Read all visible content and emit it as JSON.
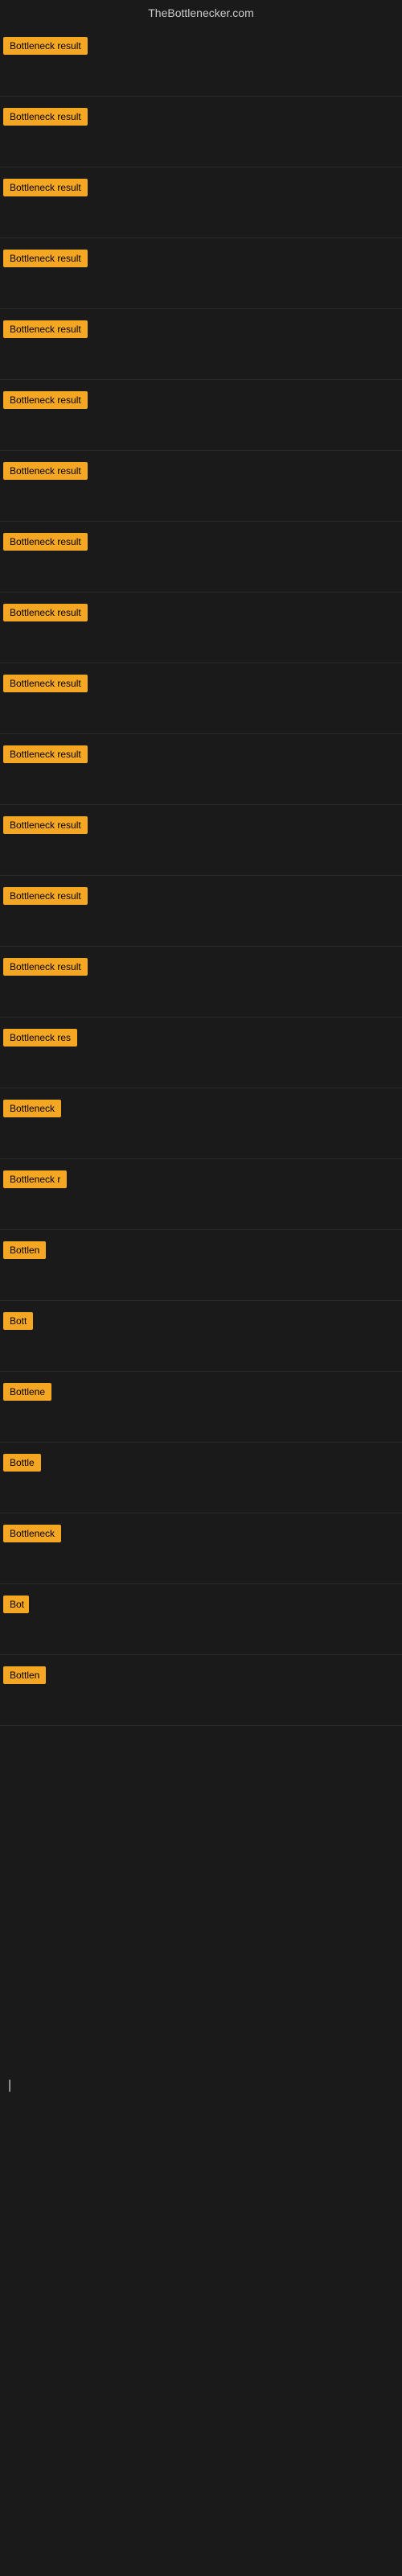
{
  "site": {
    "title": "TheBottlenecker.com"
  },
  "rows": [
    {
      "label": "Bottleneck result",
      "width": "full"
    },
    {
      "label": "Bottleneck result",
      "width": "full"
    },
    {
      "label": "Bottleneck result",
      "width": "full"
    },
    {
      "label": "Bottleneck result",
      "width": "full"
    },
    {
      "label": "Bottleneck result",
      "width": "full"
    },
    {
      "label": "Bottleneck result",
      "width": "full"
    },
    {
      "label": "Bottleneck result",
      "width": "full"
    },
    {
      "label": "Bottleneck result",
      "width": "full"
    },
    {
      "label": "Bottleneck result",
      "width": "full"
    },
    {
      "label": "Bottleneck result",
      "width": "full"
    },
    {
      "label": "Bottleneck result",
      "width": "full"
    },
    {
      "label": "Bottleneck result",
      "width": "full"
    },
    {
      "label": "Bottleneck result",
      "width": "full"
    },
    {
      "label": "Bottleneck result",
      "width": "full"
    },
    {
      "label": "Bottleneck res",
      "width": "partial"
    },
    {
      "label": "Bottleneck",
      "width": "small"
    },
    {
      "label": "Bottleneck r",
      "width": "partial-small"
    },
    {
      "label": "Bottlen",
      "width": "tiny"
    },
    {
      "label": "Bott",
      "width": "xtiny"
    },
    {
      "label": "Bottlene",
      "width": "tiny2"
    },
    {
      "label": "Bottle",
      "width": "tiny3"
    },
    {
      "label": "Bottleneck",
      "width": "small2"
    },
    {
      "label": "Bot",
      "width": "xtiny2"
    },
    {
      "label": "Bottlen",
      "width": "tiny4"
    }
  ]
}
